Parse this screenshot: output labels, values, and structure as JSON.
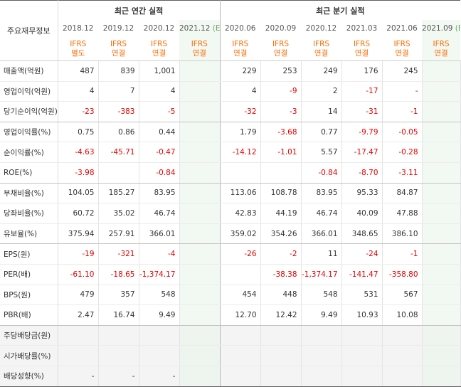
{
  "header": {
    "row_label": "주요재무정보",
    "annual_title": "최근 연간 실적",
    "quarter_title": "최근 분기 실적",
    "annual_periods": [
      "2018.12",
      "2019.12",
      "2020.12",
      "2021.12"
    ],
    "annual_est_suffix": "(E)",
    "quarter_periods": [
      "2020.06",
      "2020.09",
      "2020.12",
      "2021.03",
      "2021.06",
      "2021.09"
    ],
    "quarter_est_suffix": "(E)",
    "ifrs": "IFRS",
    "annual_basis": [
      "별도",
      "연결",
      "연결",
      "연결"
    ],
    "quarter_basis": [
      "연결",
      "연결",
      "연결",
      "연결",
      "연결",
      "연결"
    ]
  },
  "rows": [
    {
      "label": "매출액(억원)",
      "annual": [
        "487",
        "839",
        "1,001",
        ""
      ],
      "quarter": [
        "229",
        "253",
        "249",
        "176",
        "245",
        ""
      ]
    },
    {
      "label": "영업이익(억원)",
      "annual": [
        "4",
        "7",
        "4",
        ""
      ],
      "quarter": [
        "4",
        "-9",
        "2",
        "-17",
        "-",
        ""
      ]
    },
    {
      "label": "당기순이익(억원)",
      "annual": [
        "-23",
        "-383",
        "-5",
        ""
      ],
      "quarter": [
        "-32",
        "-3",
        "14",
        "-31",
        "-1",
        ""
      ]
    },
    {
      "label": "영업이익률(%)",
      "annual": [
        "0.75",
        "0.86",
        "0.44",
        ""
      ],
      "quarter": [
        "1.79",
        "-3.68",
        "0.77",
        "-9.79",
        "-0.05",
        ""
      ]
    },
    {
      "label": "순이익률(%)",
      "annual": [
        "-4.63",
        "-45.71",
        "-0.47",
        ""
      ],
      "quarter": [
        "-14.12",
        "-1.01",
        "5.57",
        "-17.47",
        "-0.28",
        ""
      ]
    },
    {
      "label": "ROE(%)",
      "annual": [
        "-3.98",
        "",
        "-0.84",
        ""
      ],
      "quarter": [
        "",
        "",
        "-0.84",
        "-8.70",
        "-3.11",
        ""
      ]
    },
    {
      "label": "부채비율(%)",
      "annual": [
        "104.05",
        "185.27",
        "83.95",
        ""
      ],
      "quarter": [
        "113.06",
        "108.78",
        "83.95",
        "95.33",
        "84.87",
        ""
      ]
    },
    {
      "label": "당좌비율(%)",
      "annual": [
        "60.72",
        "35.02",
        "46.74",
        ""
      ],
      "quarter": [
        "42.83",
        "44.19",
        "46.74",
        "40.09",
        "47.88",
        ""
      ]
    },
    {
      "label": "유보율(%)",
      "annual": [
        "375.94",
        "257.91",
        "366.01",
        ""
      ],
      "quarter": [
        "359.02",
        "354.26",
        "366.01",
        "348.65",
        "386.10",
        ""
      ]
    },
    {
      "label": "EPS(원)",
      "annual": [
        "-19",
        "-321",
        "-4",
        ""
      ],
      "quarter": [
        "-26",
        "-2",
        "11",
        "-24",
        "-1",
        ""
      ]
    },
    {
      "label": "PER(배)",
      "annual": [
        "-61.10",
        "-18.65",
        "-1,374.17",
        ""
      ],
      "quarter": [
        "",
        "-38.38",
        "-1,374.17",
        "-141.47",
        "-358.80",
        ""
      ]
    },
    {
      "label": "BPS(원)",
      "annual": [
        "479",
        "357",
        "548",
        ""
      ],
      "quarter": [
        "454",
        "448",
        "548",
        "531",
        "567",
        ""
      ]
    },
    {
      "label": "PBR(배)",
      "annual": [
        "2.47",
        "16.74",
        "9.49",
        ""
      ],
      "quarter": [
        "12.70",
        "12.42",
        "9.49",
        "10.93",
        "10.08",
        ""
      ]
    },
    {
      "label": "주당배당금(원)",
      "annual": [
        "",
        "",
        "",
        ""
      ],
      "quarter": [
        "",
        "",
        "",
        "",
        "",
        ""
      ]
    },
    {
      "label": "시가배당률(%)",
      "annual": [
        "",
        "",
        "",
        ""
      ],
      "quarter": [
        "",
        "",
        "",
        "",
        "",
        ""
      ]
    },
    {
      "label": "배당성향(%)",
      "annual": [
        "-",
        "-",
        "-",
        ""
      ],
      "quarter": [
        "",
        "",
        "",
        "",
        "",
        ""
      ]
    }
  ]
}
